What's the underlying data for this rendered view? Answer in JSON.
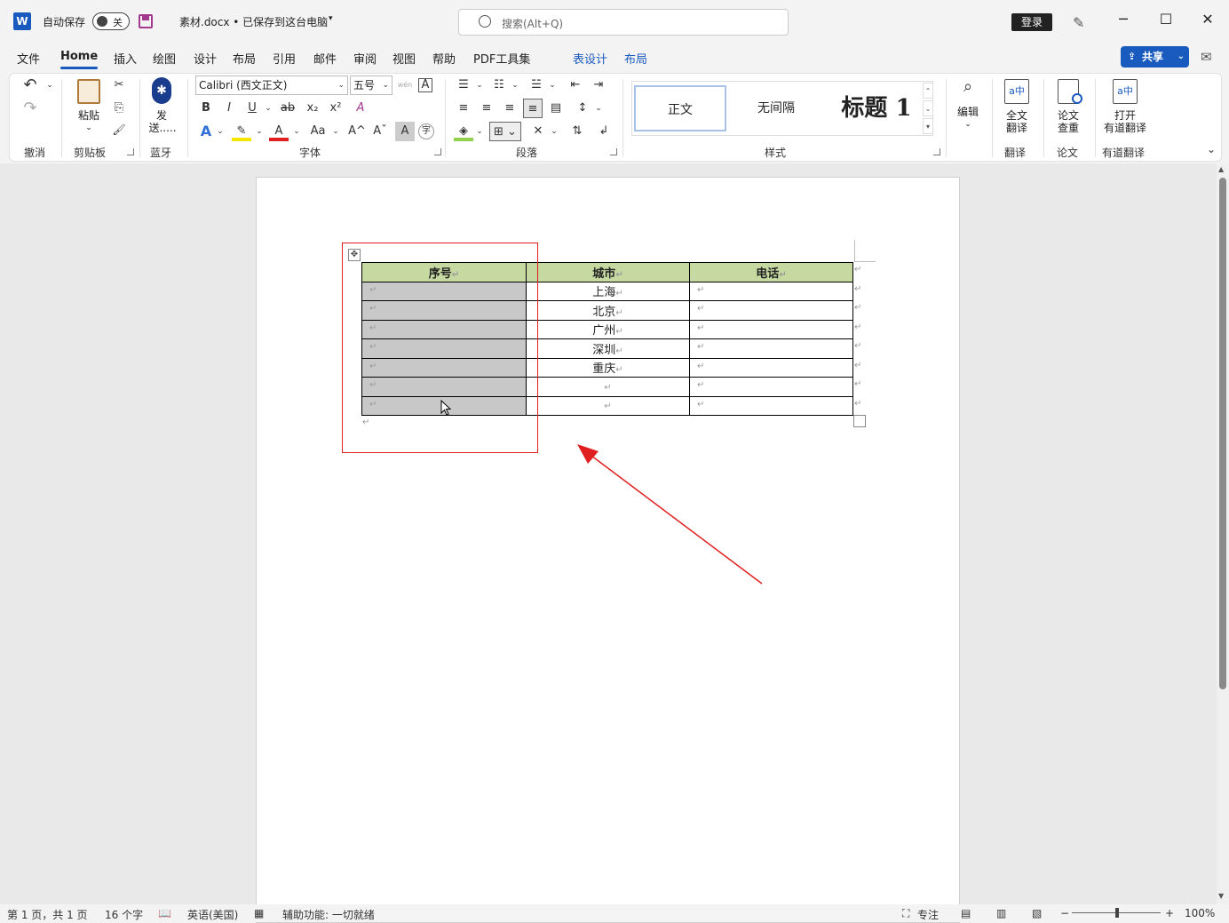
{
  "titlebar": {
    "app_icon": "W",
    "autosave_label": "自动保存",
    "autosave_state": "关",
    "doc_title": "素材.docx • 已保存到这台电脑",
    "search_placeholder": "搜索(Alt+Q)",
    "login": "登录",
    "pen_icon": "✎",
    "minimize": "─",
    "maximize": "☐",
    "close": "✕"
  },
  "menu": {
    "items": [
      "文件",
      "Home",
      "插入",
      "绘图",
      "设计",
      "布局",
      "引用",
      "邮件",
      "审阅",
      "视图",
      "帮助",
      "PDF工具集",
      "表设计",
      "布局"
    ],
    "active_index": 1,
    "share": "共享",
    "share_icon": "⇪",
    "share_caret": "⌄",
    "comment_icon": "✉"
  },
  "ribbon": {
    "undo_group": "撤消",
    "undo_icon": "↶",
    "redo_icon": "↷",
    "clipboard": {
      "label": "剪贴板",
      "paste": "粘贴",
      "cut_icon": "✂",
      "copy_icon": "⎘",
      "painter_icon": "🖌"
    },
    "bluetooth": {
      "label": "蓝牙",
      "send": "发",
      "send2": "送.....",
      "icon": "✱"
    },
    "font": {
      "label": "字体",
      "name": "Calibri (西文正文)",
      "size": "五号",
      "bold": "B",
      "italic": "I",
      "underline": "U",
      "strike": "ab",
      "sub": "x₂",
      "sup": "x²",
      "clear": "A",
      "effects": "A",
      "highlight": "✎",
      "color": "A",
      "case": "Aa",
      "grow": "A^",
      "shrink": "Aˇ",
      "shade": "A",
      "enclose": "字",
      "wen": "wén",
      "border_a": "A"
    },
    "paragraph": {
      "label": "段落"
    },
    "styles": {
      "label": "样式",
      "items": [
        "正文",
        "无间隔",
        "标题 1"
      ]
    },
    "edit": {
      "label": "编辑",
      "icon": "⌕"
    },
    "translate": {
      "label": "翻译",
      "btn_line1": "全文",
      "btn_line2": "翻译",
      "icon": "a中"
    },
    "paper": {
      "label": "论文",
      "btn_line1": "论文",
      "btn_line2": "查重"
    },
    "youdao": {
      "label": "有道翻译",
      "btn_line1": "打开",
      "btn_line2": "有道翻译"
    },
    "collapse_icon": "⌄"
  },
  "table": {
    "headers": [
      "序号",
      "城市",
      "电话"
    ],
    "rows": [
      [
        "",
        "上海",
        ""
      ],
      [
        "",
        "北京",
        ""
      ],
      [
        "",
        "广州",
        ""
      ],
      [
        "",
        "深圳",
        ""
      ],
      [
        "",
        "重庆",
        ""
      ],
      [
        "",
        "",
        ""
      ],
      [
        "",
        "",
        ""
      ]
    ],
    "para_mark": "↵",
    "move_icon": "✥"
  },
  "annotation": {
    "color": "#e02020"
  },
  "statusbar": {
    "page": "第 1 页，共 1 页",
    "words": "16 个字",
    "lang": "英语(美国)",
    "accessibility": "辅助功能: 一切就绪",
    "focus": "专注",
    "zoom_minus": "−",
    "zoom_plus": "+",
    "zoom": "100%",
    "zoom_level": 0.5
  }
}
